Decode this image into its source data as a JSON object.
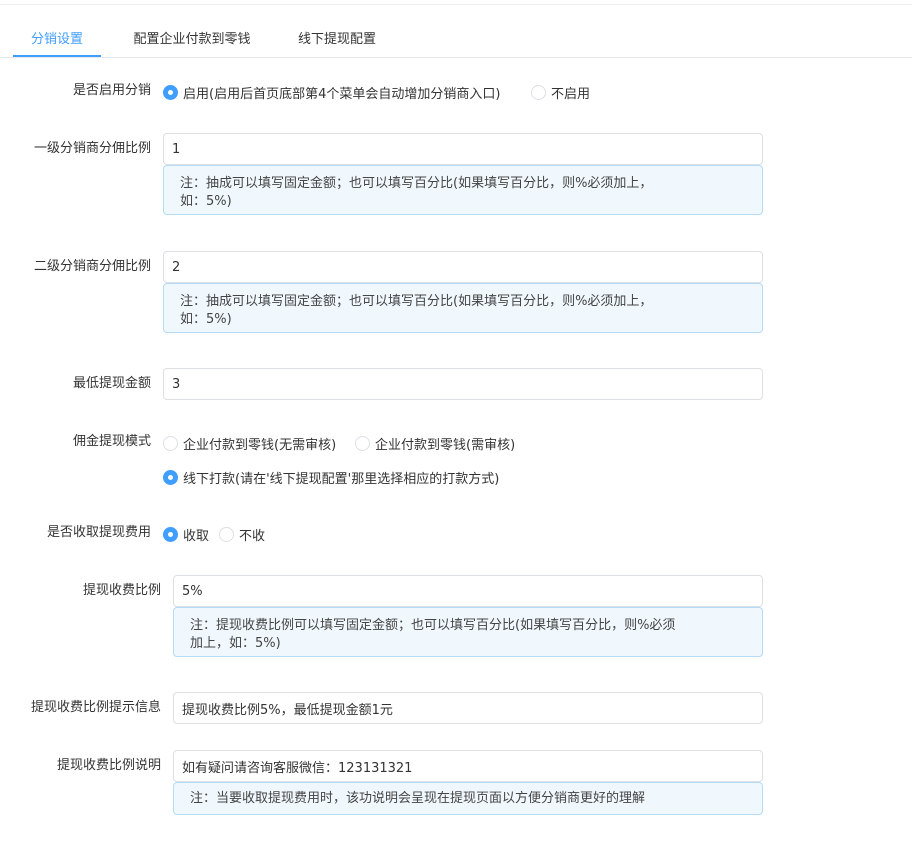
{
  "tabs": [
    {
      "label": "分销设置",
      "active": true
    },
    {
      "label": "配置企业付款到零钱",
      "active": false
    },
    {
      "label": "线下提现配置",
      "active": false
    }
  ],
  "enable": {
    "label": "是否启用分销",
    "options": [
      "启用(启用后首页底部第4个菜单会自动增加分销商入口)",
      "不启用"
    ],
    "selected": 0
  },
  "level1": {
    "label": "一级分销商分佣比例",
    "value": "1",
    "note_line1": "注：抽成可以填写固定金额；也可以填写百分比(如果填写百分比，则%必须加上，",
    "note_line2": "如：5%)"
  },
  "level2": {
    "label": "二级分销商分佣比例",
    "value": "2",
    "note_line1": "注：抽成可以填写固定金额；也可以填写百分比(如果填写百分比，则%必须加上，",
    "note_line2": "如：5%)"
  },
  "min_withdraw": {
    "label": "最低提现金额",
    "value": "3"
  },
  "withdraw_mode": {
    "label": "佣金提现模式",
    "options": [
      "企业付款到零钱(无需审核)",
      "企业付款到零钱(需审核)",
      "线下打款(请在'线下提现配置'那里选择相应的打款方式)"
    ],
    "selected": 2
  },
  "fee": {
    "label": "是否收取提现费用",
    "options": [
      "收取",
      "不收"
    ],
    "selected": 0
  },
  "fee_ratio": {
    "label": "提现收费比例",
    "value": "5%",
    "note_line1": "注：提现收费比例可以填写固定金额；也可以填写百分比(如果填写百分比，则%必须",
    "note_line2": "加上，如：5%)"
  },
  "fee_tip": {
    "label": "提现收费比例提示信息",
    "value": "提现收费比例5%，最低提现金额1元"
  },
  "fee_desc": {
    "label": "提现收费比例说明",
    "value": "如有疑问请咨询客服微信：123131321",
    "note": "注：当要收取提现费用时，该功说明会呈现在提现页面以方便分销商更好的理解"
  },
  "colors": {
    "primary": "#409eff",
    "note_bg": "#f0f8fe",
    "note_border": "#b3dcf5"
  }
}
